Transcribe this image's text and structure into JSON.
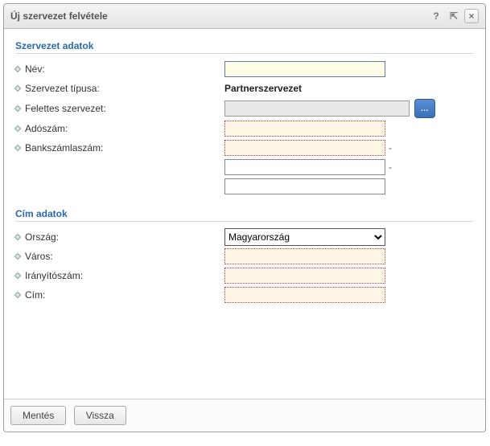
{
  "dialog": {
    "title": "Új szervezet felvétele"
  },
  "sections": {
    "org": {
      "title": "Szervezet adatok",
      "labels": {
        "name": "Név:",
        "orgtype": "Szervezet típusa:",
        "parent": "Felettes szervezet:",
        "tax": "Adószám:",
        "bank": "Bankszámlaszám:"
      },
      "values": {
        "name": "",
        "orgtype": "Partnerszervezet",
        "parent": "",
        "tax": "",
        "bank1": "",
        "bank2": "",
        "bank3": ""
      }
    },
    "addr": {
      "title": "Cím adatok",
      "labels": {
        "country": "Ország:",
        "city": "Város:",
        "zip": "Irányítószám:",
        "address": "Cím:"
      },
      "values": {
        "country": "Magyarország",
        "city": "",
        "zip": "",
        "address": ""
      },
      "country_options": [
        "Magyarország"
      ]
    }
  },
  "footer": {
    "save": "Mentés",
    "back": "Vissza"
  },
  "icons": {
    "help": "?",
    "popout": "⇱",
    "close": "×",
    "lookup": "…"
  }
}
